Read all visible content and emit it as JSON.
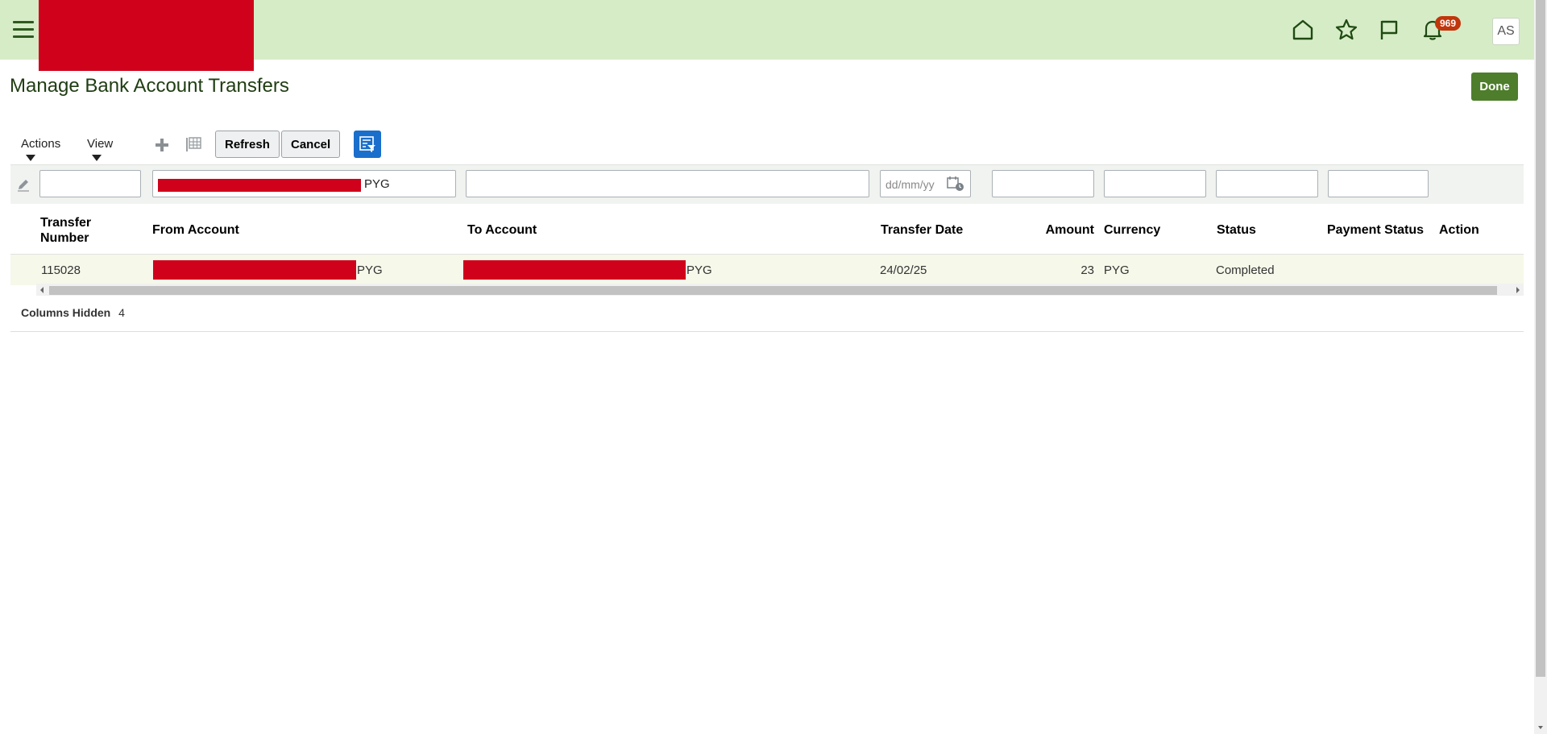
{
  "header": {
    "notification_count": "969",
    "user_initials": "AS"
  },
  "page": {
    "title": "Manage Bank Account Transfers",
    "done_label": "Done"
  },
  "toolbar": {
    "actions_label": "Actions",
    "view_label": "View",
    "refresh_label": "Refresh",
    "cancel_label": "Cancel"
  },
  "filters": {
    "from_account_value": "PYG",
    "transfer_date_placeholder": "dd/mm/yy"
  },
  "columns": {
    "transfer_number_line1": "Transfer",
    "transfer_number_line2": "Number",
    "from_account": "From Account",
    "to_account": "To Account",
    "transfer_date": "Transfer Date",
    "amount": "Amount",
    "currency": "Currency",
    "status": "Status",
    "payment_status": "Payment Status",
    "action": "Action"
  },
  "rows": [
    {
      "transfer_number": "115028",
      "from_account_suffix": "PYG",
      "to_account_suffix": "PYG",
      "transfer_date": "24/02/25",
      "amount": "23",
      "currency": "PYG",
      "status": "Completed",
      "payment_status": "",
      "action": ""
    }
  ],
  "footer": {
    "columns_hidden_label": "Columns Hidden",
    "columns_hidden_count": "4"
  },
  "colors": {
    "topbar": "#d6ecc7",
    "accent_green": "#4e7d2b",
    "redaction": "#d0021b",
    "badge": "#c1360b"
  },
  "icons": [
    "hamburger-icon",
    "home-icon",
    "star-icon",
    "flag-icon",
    "bell-icon",
    "plus-icon",
    "freeze-icon",
    "query-by-example-icon",
    "pencil-icon",
    "calendar-icon"
  ]
}
